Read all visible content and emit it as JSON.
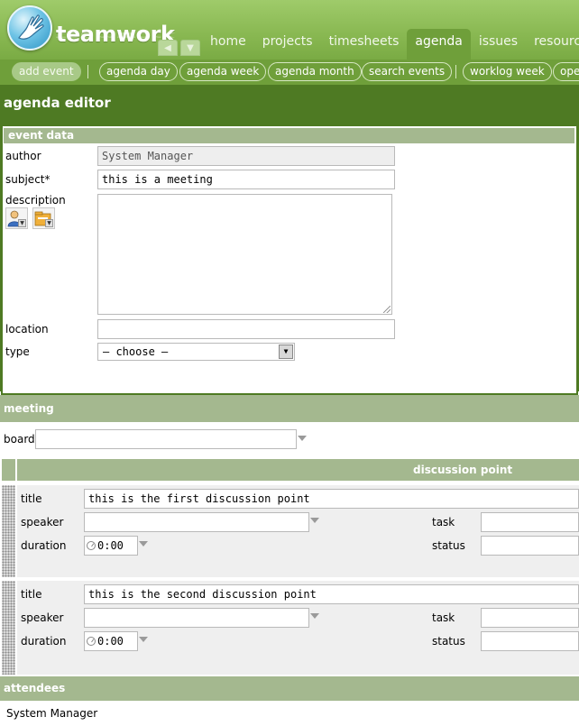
{
  "app": {
    "brand": "teamwork",
    "nav_left_glyph": "◀",
    "nav_down_glyph": "▼"
  },
  "tabs": [
    {
      "label": "home"
    },
    {
      "label": "projects"
    },
    {
      "label": "timesheets"
    },
    {
      "label": "agenda",
      "active": true
    },
    {
      "label": "issues"
    },
    {
      "label": "resources"
    }
  ],
  "toolbar": {
    "items": [
      {
        "label": "add event",
        "active": true
      },
      {
        "label": "agenda day"
      },
      {
        "label": "agenda week"
      },
      {
        "label": "agenda month"
      },
      {
        "label": "search events"
      },
      {
        "label": "worklog week"
      },
      {
        "label": "open"
      }
    ]
  },
  "page": {
    "title": "agenda editor"
  },
  "event_data": {
    "header": "event data",
    "author_label": "author",
    "author_value": "System Manager",
    "subject_label": "subject*",
    "subject_value": "this is a meeting",
    "description_label": "description",
    "description_value": "",
    "location_label": "location",
    "location_value": "",
    "type_label": "type",
    "type_value": "– choose –",
    "type_button_glyph": "▼"
  },
  "meeting": {
    "header": "meeting",
    "board_label": "board",
    "board_value": "",
    "discussion_header": "discussion point",
    "points": [
      {
        "title_label": "title",
        "title_value": "this is the first discussion point",
        "speaker_label": "speaker",
        "duration_label": "duration",
        "duration_value": "0:00",
        "task_label": "task",
        "status_label": "status"
      },
      {
        "title_label": "title",
        "title_value": "this is the second discussion point",
        "speaker_label": "speaker",
        "duration_label": "duration",
        "duration_value": "0:00",
        "task_label": "task",
        "status_label": "status"
      }
    ]
  },
  "attendees": {
    "header": "attendees",
    "list": [
      "System Manager"
    ]
  },
  "colors": {
    "header_green": "#8ab953",
    "dark_green": "#4e7a23",
    "toolbar_green": "#6f9f3a",
    "section_header": "#a4b88f",
    "row_gray": "#efefef"
  },
  "icons": [
    "logo-hand-icon",
    "arrow-left-icon",
    "arrow-down-icon",
    "user-picker-icon",
    "folder-picker-icon",
    "dropdown-arrow-icon",
    "clock-icon",
    "drag-grip-icon"
  ]
}
